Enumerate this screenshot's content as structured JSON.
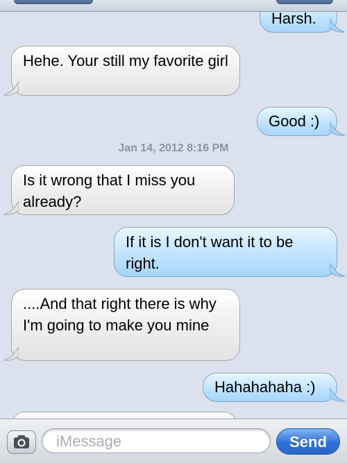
{
  "messages": [
    {
      "direction": "outgoing",
      "text": "Harsh."
    },
    {
      "direction": "incoming",
      "text": "Hehe. Your still my favorite girl"
    },
    {
      "direction": "outgoing",
      "text": "Good :)"
    },
    {
      "direction": "incoming",
      "text": "Is it wrong that I miss you already?"
    },
    {
      "direction": "outgoing",
      "text": "If it is I don't want it to be right."
    },
    {
      "direction": "incoming",
      "text": "....And that right there is why I'm going to make you mine"
    },
    {
      "direction": "outgoing",
      "text": "Hahahahaha :)"
    }
  ],
  "timestamp": "Jan 14, 2012 8:16 PM",
  "composer": {
    "placeholder": "iMessage",
    "send_label": "Send",
    "camera_icon": "camera-icon"
  },
  "colors": {
    "incoming_bubble": "#f2f2f2",
    "outgoing_bubble": "#c7e6fe",
    "send_button": "#2f73d6",
    "background": "#dbe2ed"
  }
}
